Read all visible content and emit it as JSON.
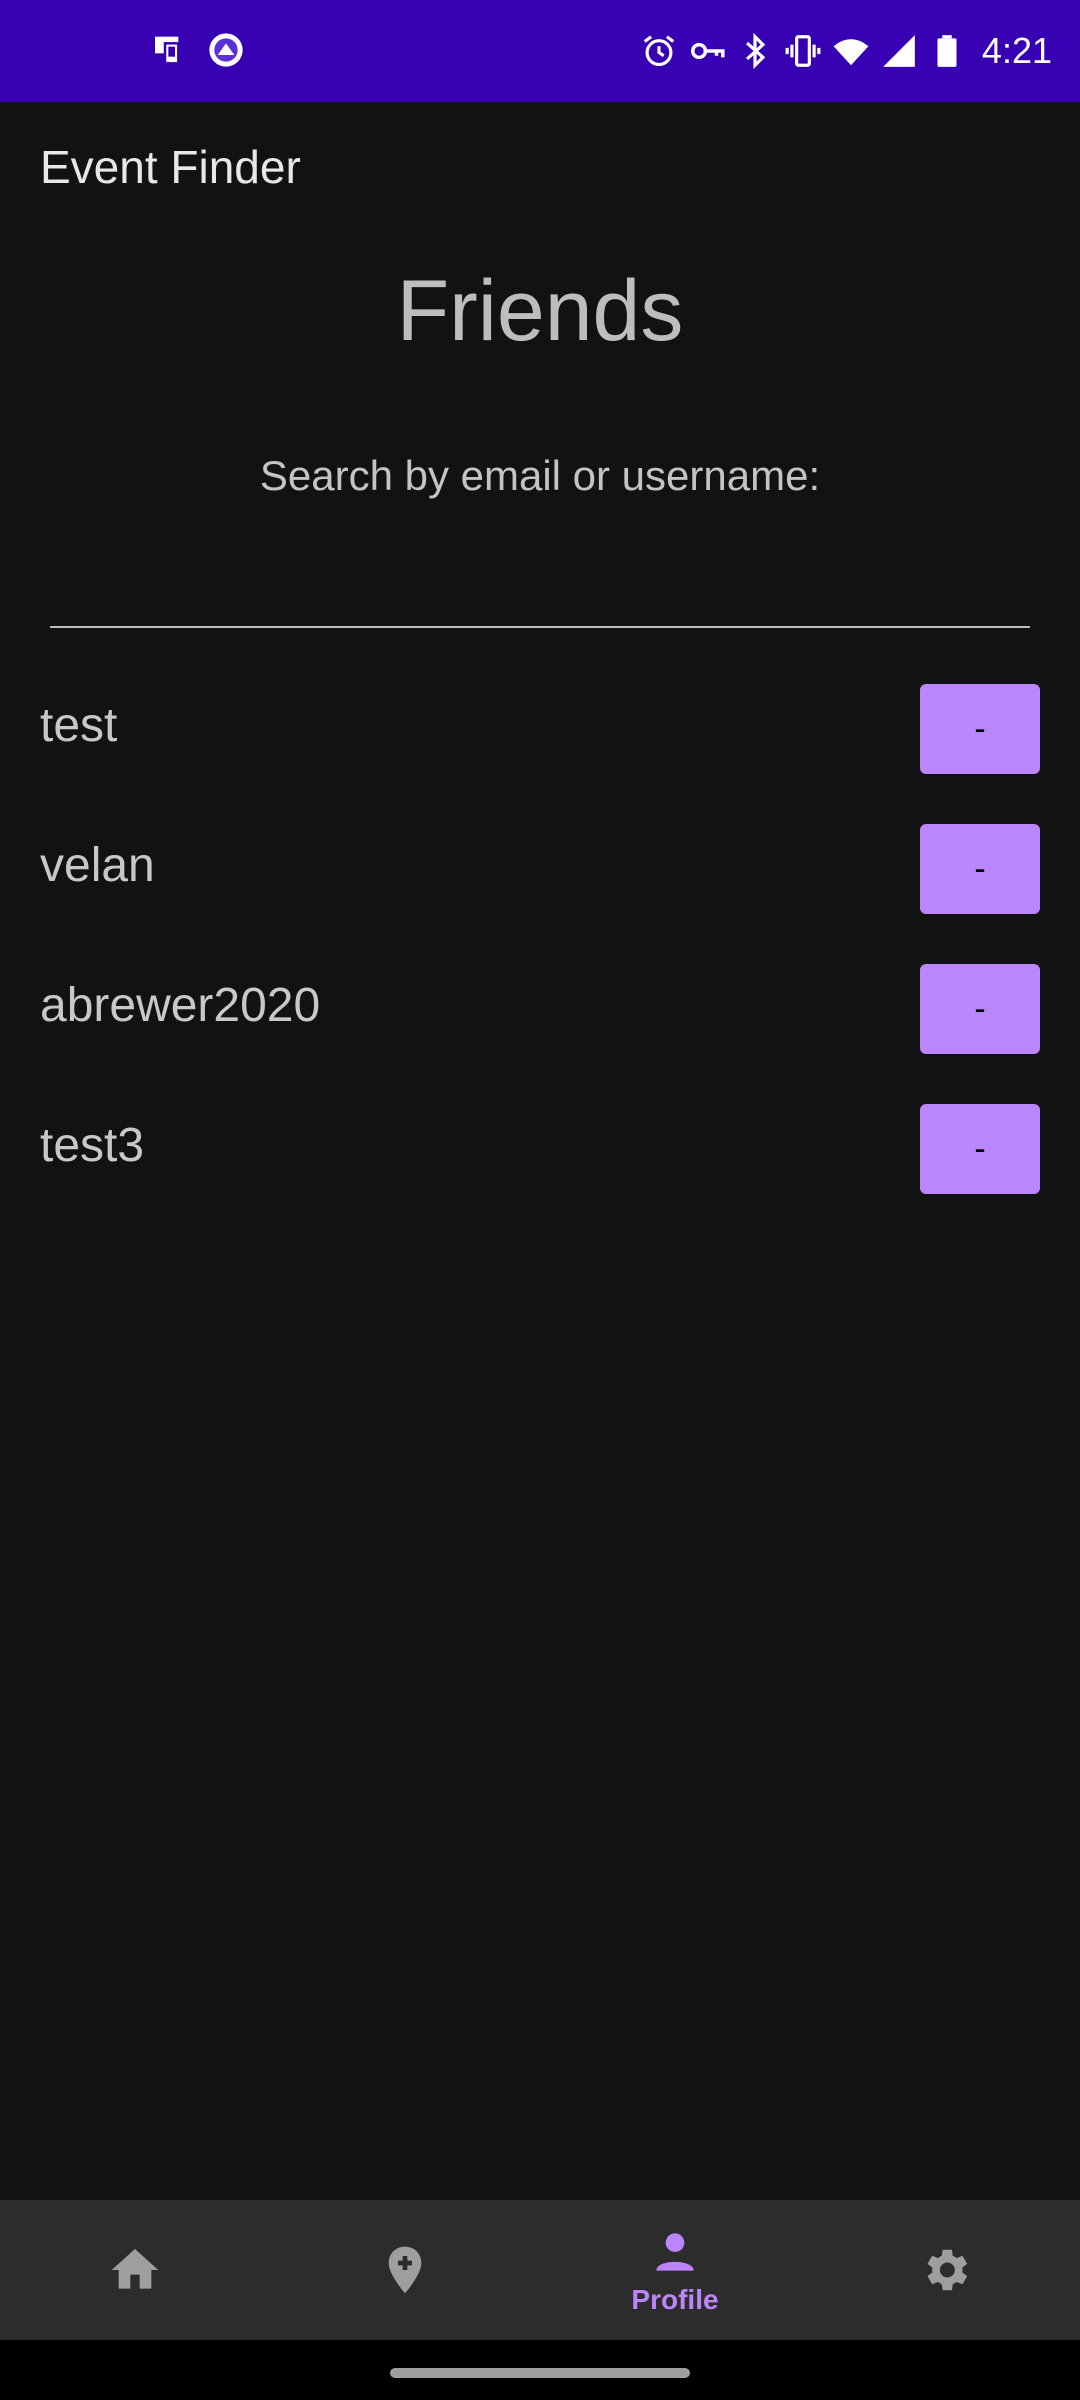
{
  "status_bar": {
    "time": "4:21",
    "left_icons": [
      "cast-icon",
      "app-notification-icon"
    ],
    "right_icons": [
      "alarm-icon",
      "vpn-key-icon",
      "bluetooth-icon",
      "vibrate-icon",
      "wifi-icon",
      "signal-icon",
      "battery-icon"
    ]
  },
  "app_bar": {
    "title": "Event Finder"
  },
  "page": {
    "title": "Friends",
    "search_label": "Search by email or username:",
    "search_value": ""
  },
  "friends": [
    {
      "name": "test",
      "button_label": "-"
    },
    {
      "name": "velan",
      "button_label": "-"
    },
    {
      "name": "abrewer2020",
      "button_label": "-"
    },
    {
      "name": "test3",
      "button_label": "-"
    }
  ],
  "bottom_nav": {
    "items": [
      {
        "icon": "home-icon",
        "label": "",
        "active": false
      },
      {
        "icon": "add-location-icon",
        "label": "",
        "active": false
      },
      {
        "icon": "person-icon",
        "label": "Profile",
        "active": true
      },
      {
        "icon": "settings-icon",
        "label": "",
        "active": false
      }
    ]
  },
  "colors": {
    "status_bar": "#3700b3",
    "background": "#121212",
    "accent": "#bb86fc",
    "nav_background": "#2c2c2c",
    "inactive_icon": "#9e9e9e"
  }
}
